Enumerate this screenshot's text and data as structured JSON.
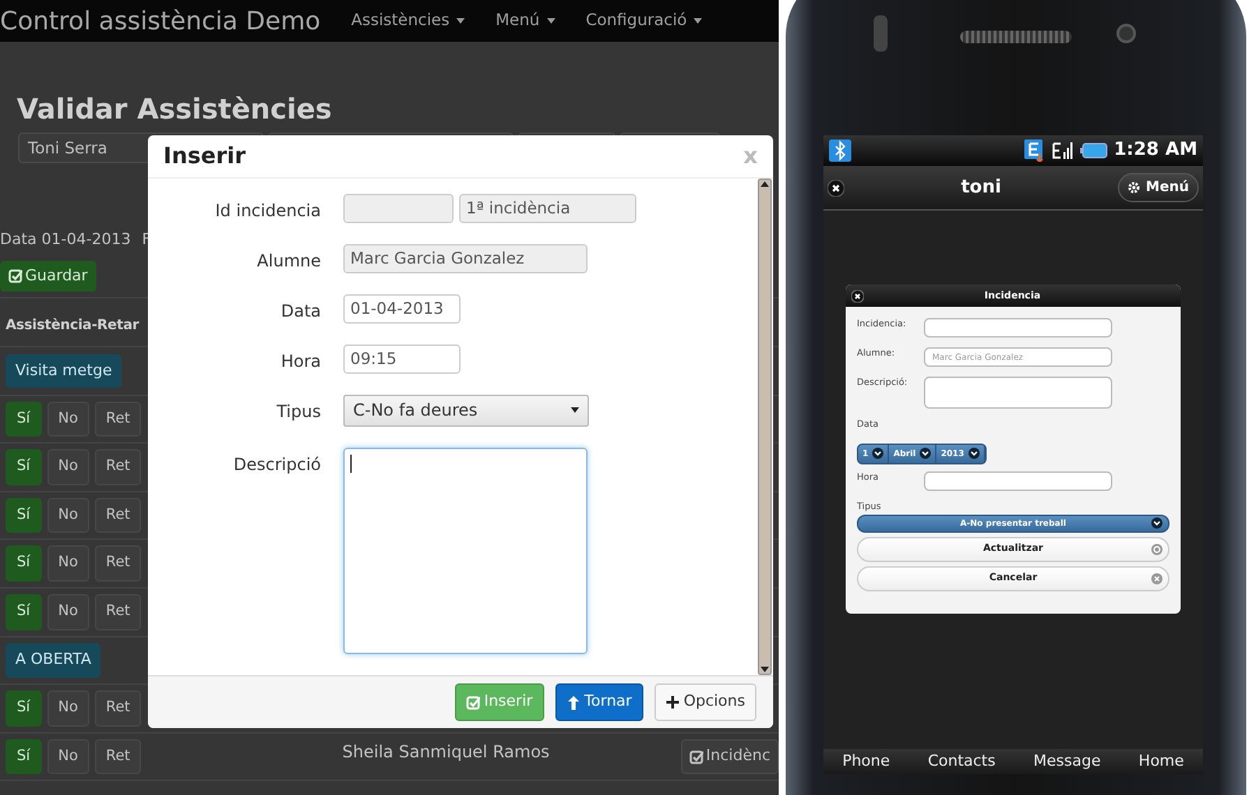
{
  "app": {
    "brand": "Control assistència Demo",
    "nav": [
      {
        "label": "Assistències"
      },
      {
        "label": "Menú"
      },
      {
        "label": "Configuració"
      }
    ]
  },
  "page": {
    "title": "Validar Assistències",
    "filter_field": {
      "value": "Toni Serra"
    },
    "date_text": "Data 01-04-2013",
    "date_text_2": "F",
    "save_button": "Guardar",
    "column_header": "Assistència-Retar",
    "rows": [
      {
        "kind": "group",
        "label": "Visita metge"
      },
      {
        "kind": "attendance",
        "choices": [
          {
            "label": "Sí",
            "selected": true
          },
          {
            "label": "No",
            "selected": false
          },
          {
            "label": "Ret",
            "selected": false
          }
        ]
      },
      {
        "kind": "attendance",
        "choices": [
          {
            "label": "Sí",
            "selected": true
          },
          {
            "label": "No",
            "selected": false
          },
          {
            "label": "Ret",
            "selected": false
          }
        ]
      },
      {
        "kind": "attendance",
        "choices": [
          {
            "label": "Sí",
            "selected": true
          },
          {
            "label": "No",
            "selected": false
          },
          {
            "label": "Ret",
            "selected": false
          }
        ]
      },
      {
        "kind": "attendance",
        "choices": [
          {
            "label": "Sí",
            "selected": true
          },
          {
            "label": "No",
            "selected": false
          },
          {
            "label": "Ret",
            "selected": false
          }
        ]
      },
      {
        "kind": "attendance",
        "choices": [
          {
            "label": "Sí",
            "selected": true
          },
          {
            "label": "No",
            "selected": false
          },
          {
            "label": "Ret",
            "selected": false
          }
        ]
      },
      {
        "kind": "group",
        "label": "A OBERTA"
      },
      {
        "kind": "attendance",
        "choices": [
          {
            "label": "Sí",
            "selected": true
          },
          {
            "label": "No",
            "selected": false
          },
          {
            "label": "Ret",
            "selected": false
          }
        ]
      },
      {
        "kind": "attendance",
        "choices": [
          {
            "label": "Sí",
            "selected": true
          },
          {
            "label": "No",
            "selected": false
          },
          {
            "label": "Ret",
            "selected": false
          }
        ],
        "student": "Sheila Sanmiquel Ramos",
        "action": "Incidènc"
      }
    ]
  },
  "modal": {
    "title": "Inserir",
    "close": "x",
    "fields": [
      {
        "kind": "double",
        "label": "Id incidencia",
        "value": "1ª incidència",
        "disabled": true
      },
      {
        "kind": "text",
        "label": "Alumne",
        "value": "Marc Garcia Gonzalez",
        "disabled": true
      },
      {
        "kind": "text",
        "label": "Data",
        "value": "01-04-2013",
        "disabled": false
      },
      {
        "kind": "text",
        "label": "Hora",
        "value": "09:15",
        "disabled": false
      },
      {
        "kind": "select",
        "label": "Tipus",
        "value": "C-No fa deures"
      },
      {
        "kind": "textarea",
        "label": "Descripció",
        "focused": true
      }
    ],
    "buttons": [
      {
        "kind": "success",
        "label": "Inserir"
      },
      {
        "kind": "primary",
        "label": "Tornar"
      },
      {
        "kind": "default",
        "label": "Opcions"
      }
    ]
  },
  "phone": {
    "status": {
      "time": "1:28 AM"
    },
    "header": {
      "title": "toni",
      "menu_button": "Menú"
    },
    "dialog": {
      "title": "Incidencia",
      "fields": [
        {
          "kind": "text",
          "label": "Incidencia:"
        },
        {
          "kind": "text",
          "label": "Alumne:",
          "value": "Marc Garcia Gonzalez"
        },
        {
          "kind": "textarea",
          "label": "Descripció:"
        },
        {
          "kind": "date",
          "label": "Data",
          "parts": [
            "1",
            "Abril",
            "2013"
          ]
        },
        {
          "kind": "text",
          "label": "Hora"
        },
        {
          "kind": "select",
          "label": "Tipus",
          "value": "A-No presentar treball"
        }
      ],
      "buttons": [
        {
          "kind": "confirm",
          "label": "Actualitzar"
        },
        {
          "kind": "cancel",
          "label": "Cancelar"
        }
      ]
    },
    "bottom_nav": [
      {
        "label": "Phone"
      },
      {
        "label": "Contacts"
      },
      {
        "label": "Message"
      },
      {
        "label": "Home"
      }
    ]
  }
}
